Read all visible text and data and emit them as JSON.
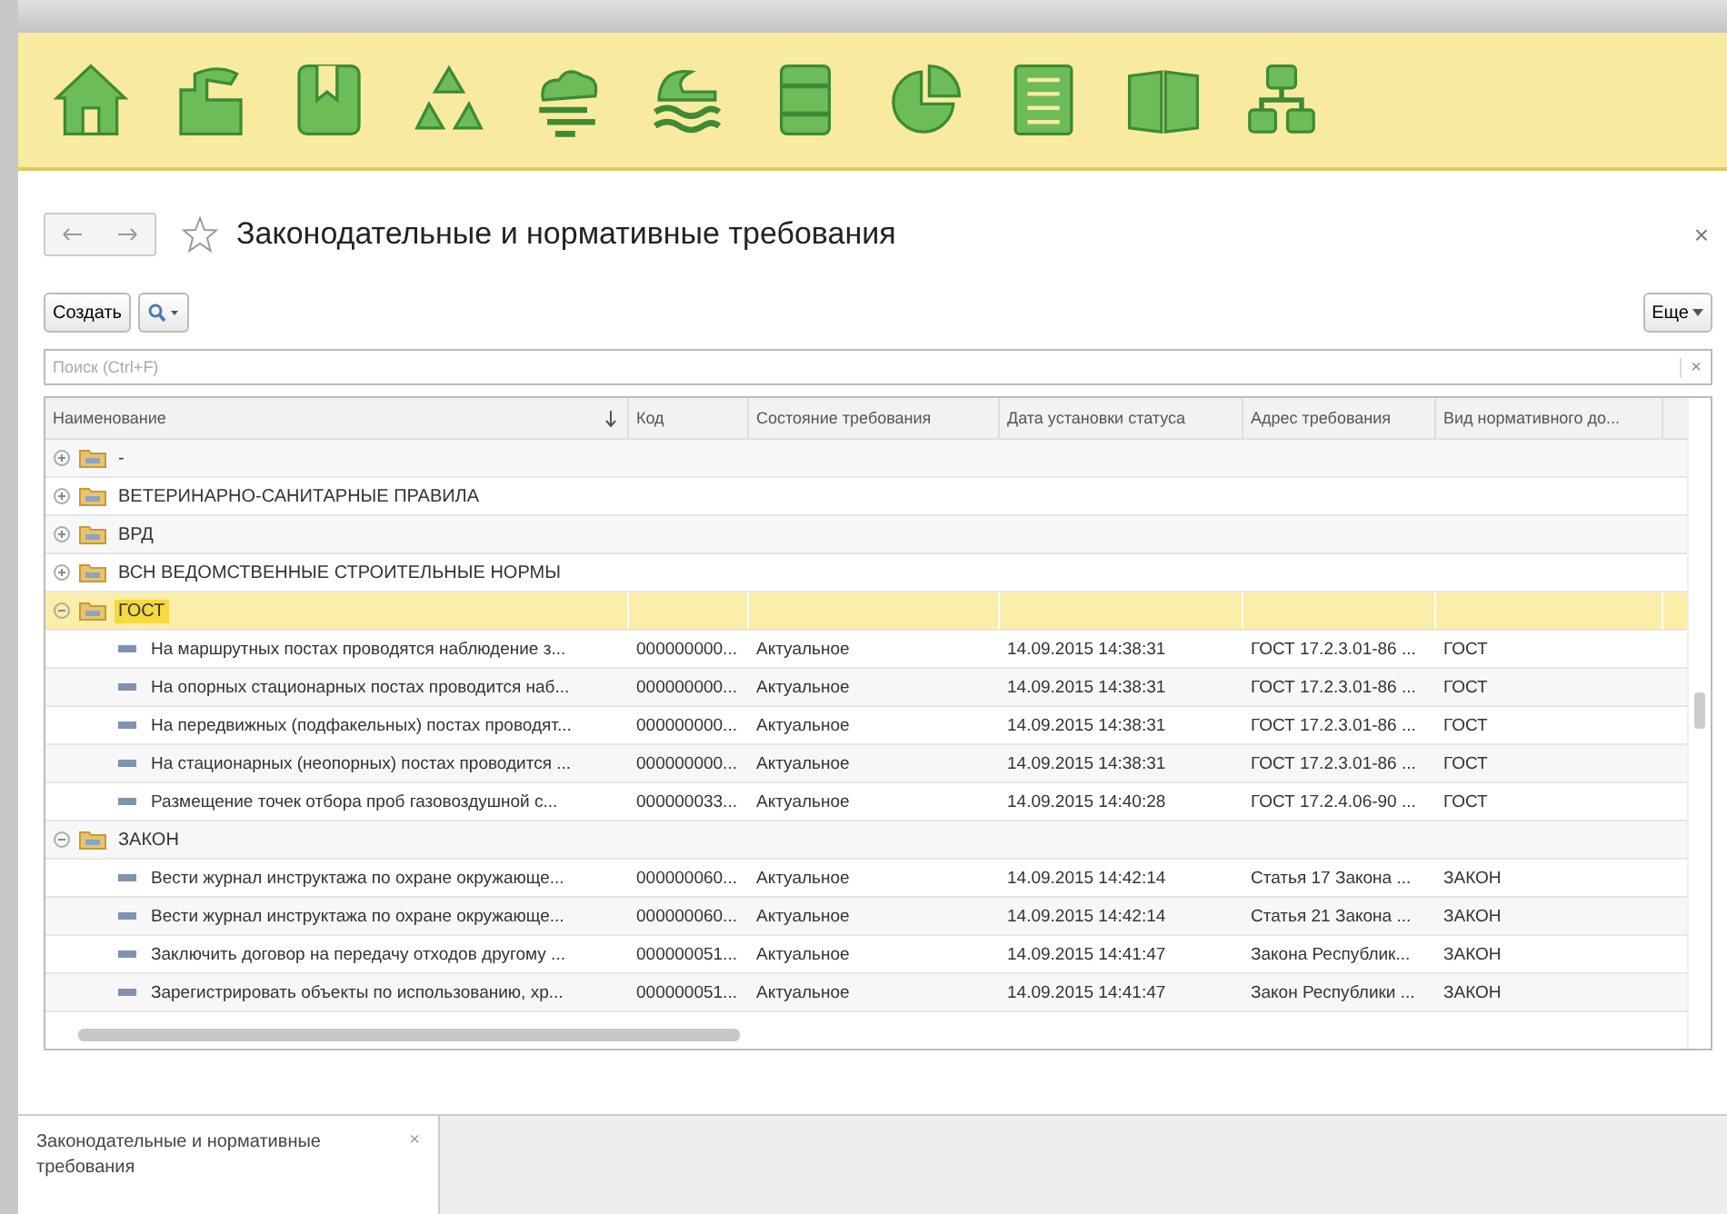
{
  "toolbar": {
    "icons": [
      {
        "kind": "home"
      },
      {
        "kind": "factory"
      },
      {
        "kind": "book"
      },
      {
        "kind": "recycle"
      },
      {
        "kind": "cloud"
      },
      {
        "kind": "waves"
      },
      {
        "kind": "barrel"
      },
      {
        "kind": "pie"
      },
      {
        "kind": "sheet"
      },
      {
        "kind": "openbook"
      },
      {
        "kind": "hierarchy"
      }
    ]
  },
  "form": {
    "title": "Законодательные и нормативные требования",
    "close": "×"
  },
  "buttons": {
    "create": "Создать",
    "more": "Еще"
  },
  "search": {
    "placeholder": "Поиск (Ctrl+F)",
    "clear": "×"
  },
  "table": {
    "columns": [
      {
        "label": "Наименование",
        "sorted": true
      },
      {
        "label": "Код",
        "sorted": false
      },
      {
        "label": "Состояние требования",
        "sorted": false
      },
      {
        "label": "Дата установки статуса",
        "sorted": false
      },
      {
        "label": "Адрес требования",
        "sorted": false
      },
      {
        "label": "Вид нормативного до...",
        "sorted": false
      }
    ],
    "rows": [
      {
        "name": "-",
        "expanded": false,
        "selected": false,
        "children": []
      },
      {
        "name": "ВЕТЕРИНАРНО-САНИТАРНЫЕ ПРАВИЛА",
        "expanded": false,
        "selected": false,
        "children": []
      },
      {
        "name": "ВРД",
        "expanded": false,
        "selected": false,
        "children": []
      },
      {
        "name": "ВСН ВЕДОМСТВЕННЫЕ СТРОИТЕЛЬНЫЕ НОРМЫ",
        "expanded": false,
        "selected": false,
        "children": []
      },
      {
        "name": "ГОСТ",
        "expanded": true,
        "selected": true,
        "children": [
          {
            "name": "На маршрутных постах проводятся наблюдение з...",
            "code": "000000000...",
            "state": "Актуальное",
            "date": "14.09.2015 14:38:31",
            "address": "ГОСТ 17.2.3.01-86 ...",
            "doc_type": "ГОСТ"
          },
          {
            "name": "На опорных стационарных постах проводится наб...",
            "code": "000000000...",
            "state": "Актуальное",
            "date": "14.09.2015 14:38:31",
            "address": "ГОСТ 17.2.3.01-86 ...",
            "doc_type": "ГОСТ"
          },
          {
            "name": "На передвижных (подфакельных) постах проводят...",
            "code": "000000000...",
            "state": "Актуальное",
            "date": "14.09.2015 14:38:31",
            "address": "ГОСТ 17.2.3.01-86 ...",
            "doc_type": "ГОСТ"
          },
          {
            "name": "На стационарных (неопорных) постах проводится ...",
            "code": "000000000...",
            "state": "Актуальное",
            "date": "14.09.2015 14:38:31",
            "address": "ГОСТ 17.2.3.01-86 ...",
            "doc_type": "ГОСТ"
          },
          {
            "name": "Размещение точек отбора проб газовоздушной с...",
            "code": "000000033...",
            "state": "Актуальное",
            "date": "14.09.2015 14:40:28",
            "address": "ГОСТ 17.2.4.06-90 ...",
            "doc_type": "ГОСТ"
          }
        ]
      },
      {
        "name": "ЗАКОН",
        "expanded": true,
        "selected": false,
        "children": [
          {
            "name": "Вести журнал инструктажа по охране окружающе...",
            "code": "000000060...",
            "state": "Актуальное",
            "date": "14.09.2015 14:42:14",
            "address": "Статья 17 Закона ...",
            "doc_type": "ЗАКОН"
          },
          {
            "name": "Вести журнал инструктажа по охране окружающе...",
            "code": "000000060...",
            "state": "Актуальное",
            "date": "14.09.2015 14:42:14",
            "address": "Статья 21 Закона ...",
            "doc_type": "ЗАКОН"
          },
          {
            "name": "Заключить договор на передачу отходов другому ...",
            "code": "000000051...",
            "state": "Актуальное",
            "date": "14.09.2015 14:41:47",
            "address": "Закона Республик...",
            "doc_type": "ЗАКОН"
          },
          {
            "name": "Зарегистрировать объекты по использованию, хр...",
            "code": "000000051...",
            "state": "Актуальное",
            "date": "14.09.2015 14:41:47",
            "address": "Закон Республики ...",
            "doc_type": "ЗАКОН"
          }
        ]
      }
    ]
  },
  "bottom_tabs": [
    {
      "label": "Законодательные и нормативные требования",
      "close": "×",
      "selected": true
    }
  ]
}
